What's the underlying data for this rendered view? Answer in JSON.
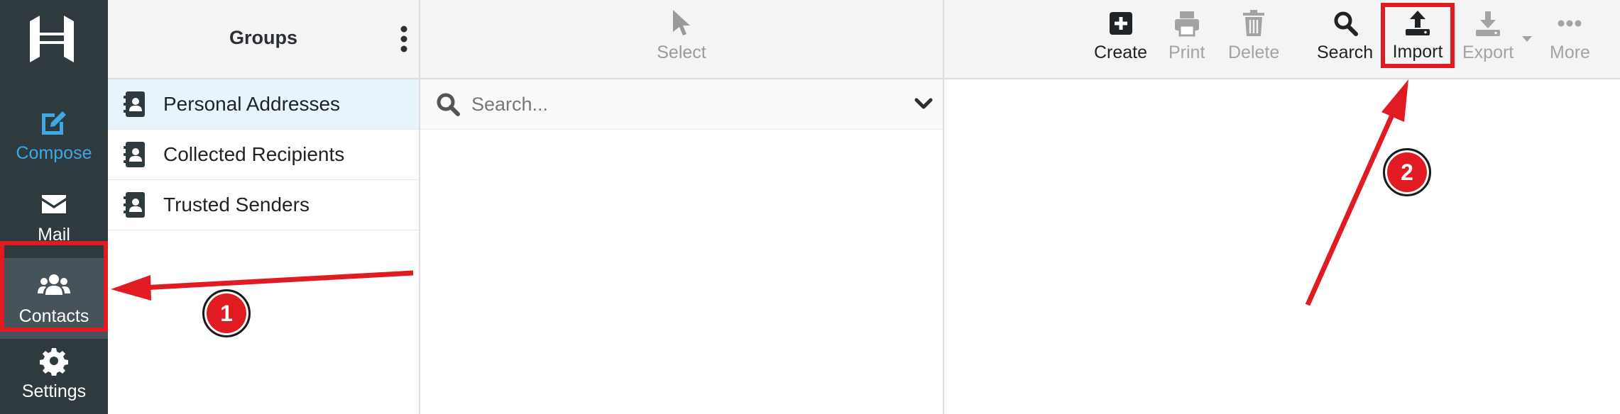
{
  "nav": {
    "items": [
      {
        "label": "Compose",
        "icon": "compose-icon"
      },
      {
        "label": "Mail",
        "icon": "envelope-icon"
      },
      {
        "label": "Contacts",
        "icon": "users-icon"
      },
      {
        "label": "Settings",
        "icon": "gear-icon"
      }
    ]
  },
  "groups": {
    "title": "Groups",
    "items": [
      {
        "label": "Personal Addresses"
      },
      {
        "label": "Collected Recipients"
      },
      {
        "label": "Trusted Senders"
      }
    ]
  },
  "list": {
    "select_label": "Select",
    "search_placeholder": "Search..."
  },
  "toolbar": {
    "create": "Create",
    "print": "Print",
    "delete": "Delete",
    "search": "Search",
    "import": "Import",
    "export": "Export",
    "more": "More"
  },
  "annotations": {
    "step1": "1",
    "step2": "2"
  },
  "colors": {
    "rail": "#2f3a3f",
    "accent": "#3aa9e6",
    "annotation": "#e01b22"
  }
}
